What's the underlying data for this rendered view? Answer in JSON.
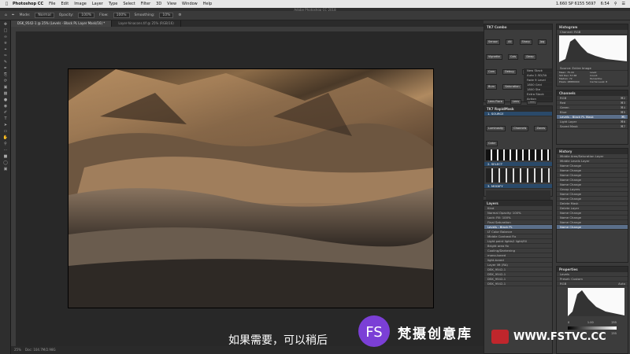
{
  "menubar": {
    "app_name": "Photoshop CC",
    "items": [
      "File",
      "Edit",
      "Image",
      "Layer",
      "Type",
      "Select",
      "Filter",
      "3D",
      "View",
      "Window",
      "Help"
    ],
    "right_status": "1.660 SP 6155 5697",
    "time": "6:54"
  },
  "window_title": "Adobe Photoshop CC 2018",
  "options": {
    "mode_label": "Mode:",
    "mode_value": "Normal",
    "opacity_label": "Opacity:",
    "opacity_value": "100%",
    "flow_label": "Flow:",
    "flow_value": "100%",
    "smoothing_label": "Smoothing:",
    "smoothing_value": "10%"
  },
  "doc_tabs": [
    {
      "label": "DSK_9542-1 @ 25% (Levels - Black PL Layer Mask/16) *",
      "active": true
    },
    {
      "label": "Layer-hinacons.tif @ 25% (RGB/16)",
      "active": false
    }
  ],
  "status": {
    "zoom": "25%",
    "doc": "Doc: 104.7M/2.98G"
  },
  "panels": {
    "tk7_title": "TK7 Combo",
    "tk7_buttons": [
      "Sensor",
      "All",
      "Sharp",
      "Jpg",
      "Vignette",
      "Cols",
      "Deep",
      "Cam",
      "Debug",
      "Dodge",
      "Burn",
      "Saturation",
      "Fuzzy",
      "Lens Flare",
      "Lens",
      "Tint",
      "Toggle",
      "3 x",
      "Sky",
      "Layer",
      "HDR",
      "Spot"
    ],
    "tk7_list": [
      "New Stack",
      "Auto 2.5D/3A",
      "Fade 9 Level",
      "1800 Grid",
      "1800 Ste",
      "Extra Stack",
      "Action",
      "sRGB"
    ],
    "rapid_title": "TK7 RapidMask",
    "rapid_source": "1. SOURCE",
    "rapid_sections": [
      "Luminosity",
      "Channels",
      "Zones",
      "Color"
    ],
    "rapid_select": "2. SELECT",
    "rapid_modify": "3. MODIFY",
    "rapid_output": "4. OUTPUT",
    "histogram_title": "Histogram",
    "hist_channel_label": "Channel:",
    "hist_channel": "RGB",
    "hist_source_label": "Source:",
    "hist_source": "Entire Image",
    "hist_stats": [
      "Mean: 75.44",
      "Std Dev: 57.68",
      "Median: 72",
      "Pixels: 28880000",
      "Level:",
      "Count:",
      "Percentile:",
      "Cache Level: 8"
    ],
    "channels_title": "Channels",
    "channels": [
      {
        "name": "RGB",
        "key": "⌘2"
      },
      {
        "name": "Red",
        "key": "⌘3"
      },
      {
        "name": "Green",
        "key": "⌘4"
      },
      {
        "name": "Blue",
        "key": "⌘5"
      },
      {
        "name": "Levels - Black PL Mask",
        "key": "⌘\\",
        "sel": true
      },
      {
        "name": "Light Layer",
        "key": "⌘6"
      },
      {
        "name": "Saved Mask",
        "key": "⌘7"
      }
    ],
    "history_title": "History",
    "history": [
      "Middle Area/Saturation Layer",
      "Middle Levels Layer",
      "Name Change",
      "Name Change",
      "Name Change",
      "Name Change",
      "Name Change",
      "Group Layers",
      "Name Change",
      "Name Change",
      "Delete Mask",
      "Delete Layer",
      "Name Change",
      "Name Change",
      "Name Change",
      "Name Change"
    ],
    "layers_title": "Layers",
    "layers_kind": "Kind",
    "layers_mode": "Normal",
    "layers_opacity_label": "Opacity:",
    "layers_opacity": "100%",
    "layers_fill_label": "Fill:",
    "layers_fill": "100%",
    "layers_lock_label": "Lock:",
    "layers": [
      "Final Saturation",
      "Levels - Black PL",
      "LT Color Balance",
      "Middle Contrast Fix",
      "Light paint lights2 light/fill",
      "Bright area fix",
      "Cooling/Darkening",
      "mono-toned",
      "light-toned",
      "Layer lift (RA)",
      "DSK_9542-1",
      "DSK_9542-1",
      "DSK_9542-1",
      "DSK_9542-1"
    ],
    "properties_title": "Properties",
    "props_type": "Levels",
    "props_preset_label": "Preset:",
    "props_preset": "Custom",
    "props_channel": "RGB",
    "props_auto": "Auto",
    "props_input": [
      "0",
      "1.00",
      "255"
    ],
    "props_output": [
      "0",
      "255"
    ]
  },
  "subtitle": "如果需要，可以稍后",
  "watermark": {
    "logo": "FS",
    "name": "梵摄创意库",
    "url": "WWW.FSTVC.CC"
  }
}
